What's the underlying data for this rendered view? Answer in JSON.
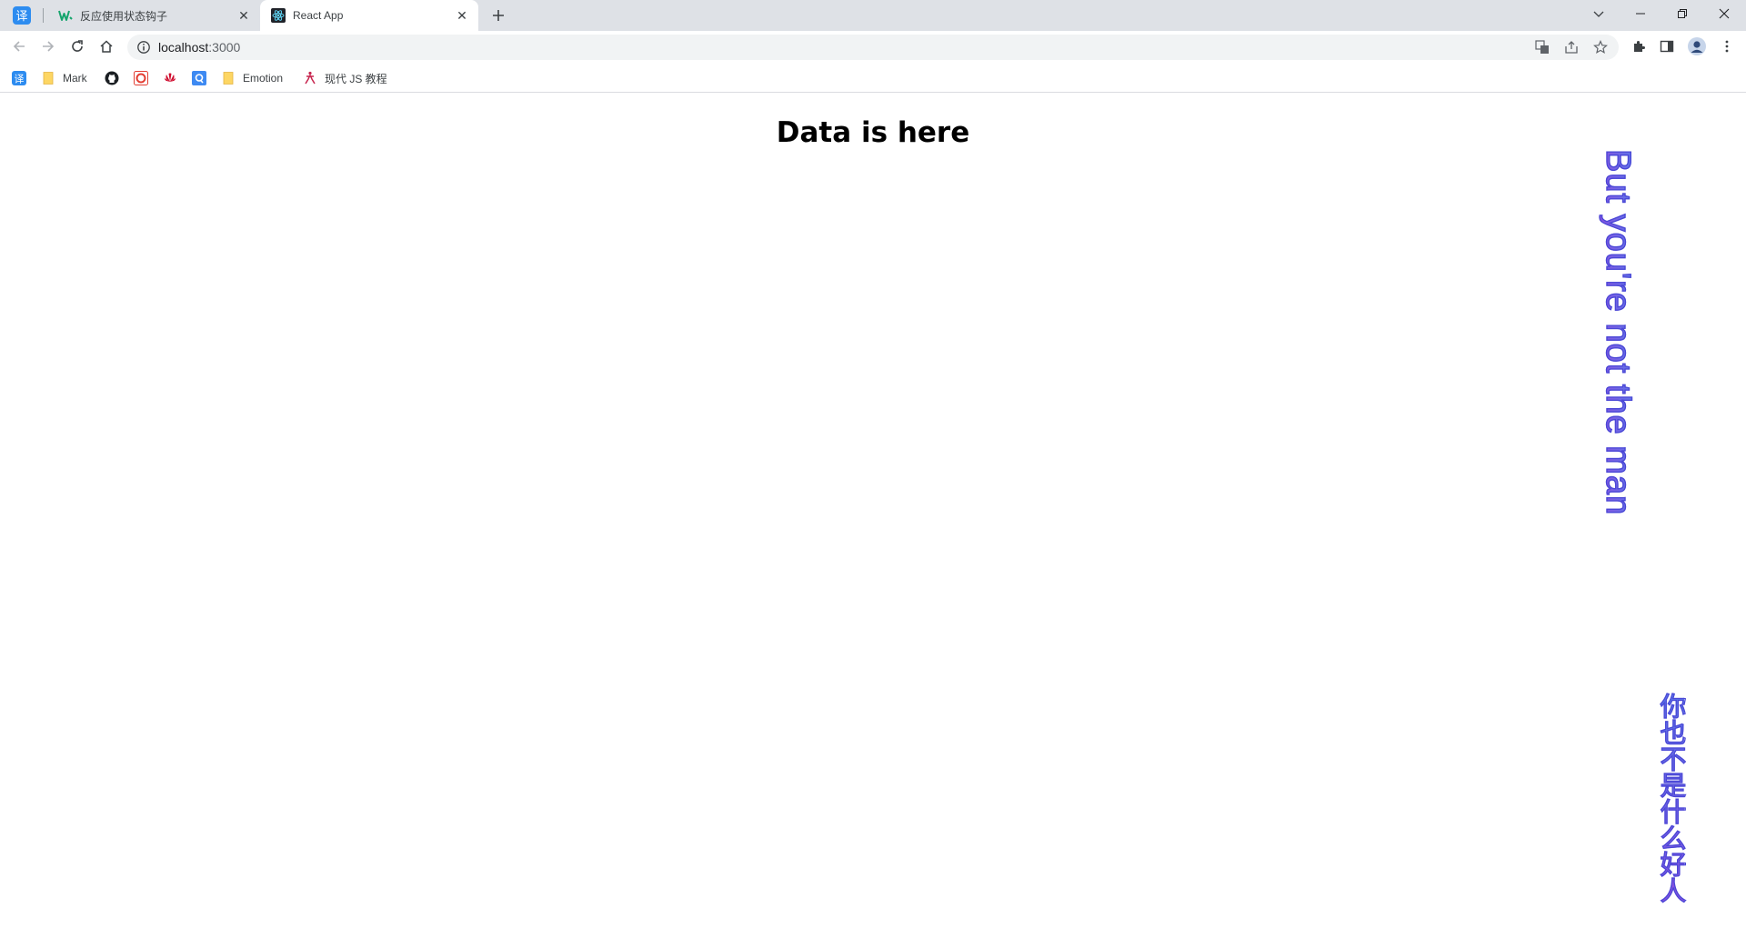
{
  "browser": {
    "tabs": [
      {
        "title": "反应使用状态钩子",
        "favicon": "w-logo-icon",
        "active": false
      },
      {
        "title": "React App",
        "favicon": "react-logo-icon",
        "active": true
      }
    ],
    "pinned_tab_label": "译",
    "address": {
      "host": "localhost",
      "port": ":3000"
    },
    "bookmarks": [
      {
        "label": "",
        "icon": "translate-icon"
      },
      {
        "label": "Mark",
        "icon": "folder-icon"
      },
      {
        "label": "",
        "icon": "github-icon"
      },
      {
        "label": "",
        "icon": "csdn-icon"
      },
      {
        "label": "",
        "icon": "huawei-icon"
      },
      {
        "label": "",
        "icon": "qr-icon"
      },
      {
        "label": "Emotion",
        "icon": "folder-icon"
      },
      {
        "label": "现代 JS 教程",
        "icon": "js-tutorial-icon"
      }
    ]
  },
  "page": {
    "heading": "Data is here",
    "vertical_text_en": "But you're not the man",
    "vertical_text_cn": "你也不是什么好人"
  },
  "colors": {
    "tabstrip": "#dee1e6",
    "text_stroke": "#4a47d6",
    "gradient_start": "#5a7be9",
    "gradient_end": "#8a4fe0"
  }
}
